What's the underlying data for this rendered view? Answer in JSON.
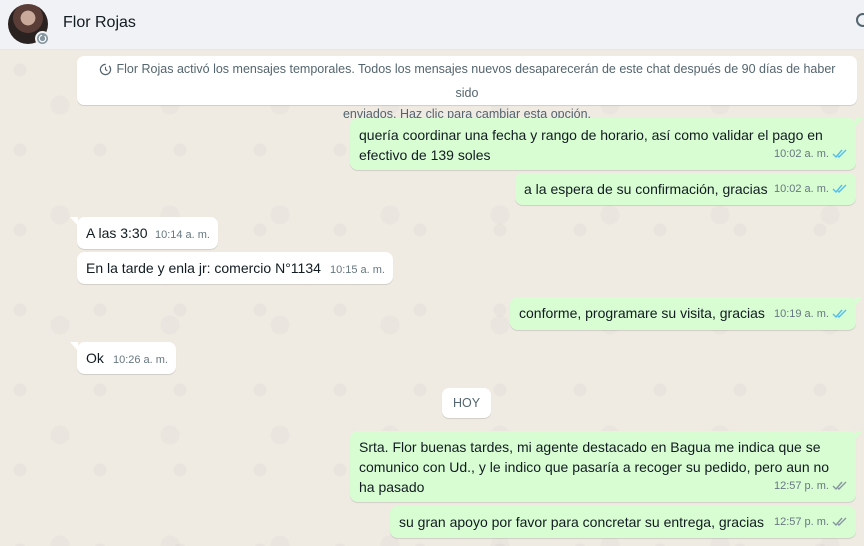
{
  "header": {
    "contact_name": "Flor Rojas"
  },
  "system_notice": {
    "line1": "Flor Rojas activó los mensajes temporales. Todos los mensajes nuevos desaparecerán de este chat después de 90 días de haber sido",
    "line2": "enviados. Haz clic para cambiar esta opción."
  },
  "messages": [
    {
      "direction": "out",
      "lines": [
        "quería coordinar una fecha y rango de horario, así como validar el pago en",
        "efectivo de 139 soles"
      ],
      "time": "10:02 a. m.",
      "status": "read"
    },
    {
      "direction": "out",
      "lines": [
        "a la espera de su confirmación, gracias"
      ],
      "time": "10:02 a. m.",
      "status": "read"
    },
    {
      "direction": "in",
      "lines": [
        "A las 3:30"
      ],
      "time": "10:14 a. m."
    },
    {
      "direction": "in",
      "lines": [
        "En la tarde y enla jr: comercio N°1134"
      ],
      "time": "10:15 a. m."
    },
    {
      "direction": "out",
      "lines": [
        "conforme, programare su visita, gracias"
      ],
      "time": "10:19 a. m.",
      "status": "read"
    },
    {
      "direction": "in",
      "lines": [
        "Ok"
      ],
      "time": "10:26 a. m."
    },
    {
      "direction": "out",
      "lines": [
        "Srta. Flor buenas tardes, mi agente destacado en Bagua me indica que se",
        "comunico con Ud., y le indico que pasaría a recoger su pedido, pero aun no",
        "ha pasado"
      ],
      "time": "12:57 p. m.",
      "status": "delivered"
    },
    {
      "direction": "out",
      "lines": [
        "su gran apoyo por favor para concretar su entrega, gracias"
      ],
      "time": "12:57 p. m.",
      "status": "delivered"
    }
  ],
  "day_divider": "HOY",
  "colors": {
    "chat_background": "#efeae2",
    "outgoing_bubble": "#d9fdd3",
    "incoming_bubble": "#ffffff",
    "read_ticks": "#53bdeb",
    "delivered_ticks": "#8696a0"
  },
  "icons": {
    "avatar_badge": "disappearing-messages-icon",
    "notice": "timer-icon",
    "read": "double-check-blue-icon",
    "delivered": "double-check-gray-icon"
  }
}
